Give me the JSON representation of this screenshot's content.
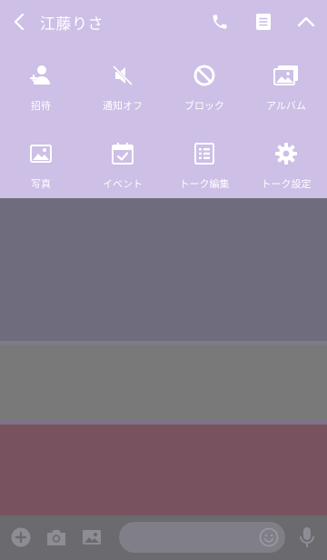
{
  "header": {
    "title": "江藤りさ",
    "icons": [
      "back-icon",
      "phone-icon",
      "notes-icon",
      "collapse-chevron-icon"
    ]
  },
  "menu": {
    "items": [
      {
        "label": "招待",
        "icon": "invite-user-icon"
      },
      {
        "label": "通知オフ",
        "icon": "mute-speaker-icon"
      },
      {
        "label": "ブロック",
        "icon": "block-icon"
      },
      {
        "label": "アルバム",
        "icon": "album-icon"
      },
      {
        "label": "写真",
        "icon": "photo-icon"
      },
      {
        "label": "イベント",
        "icon": "calendar-icon"
      },
      {
        "label": "トーク編集",
        "icon": "chat-edit-icon"
      },
      {
        "label": "トーク設定",
        "icon": "gear-icon"
      }
    ]
  },
  "composer": {
    "placeholder": "",
    "icons": [
      "plus-icon",
      "camera-icon",
      "image-icon",
      "emoji-icon",
      "microphone-icon"
    ]
  },
  "colors": {
    "header_bg": "#cdbfe6",
    "icon_fg": "#ffffff",
    "chat_dark": "#6f6d7d",
    "chat_gray": "#797979",
    "chat_red": "#78535f",
    "composer_bg": "#6b6a6e"
  }
}
